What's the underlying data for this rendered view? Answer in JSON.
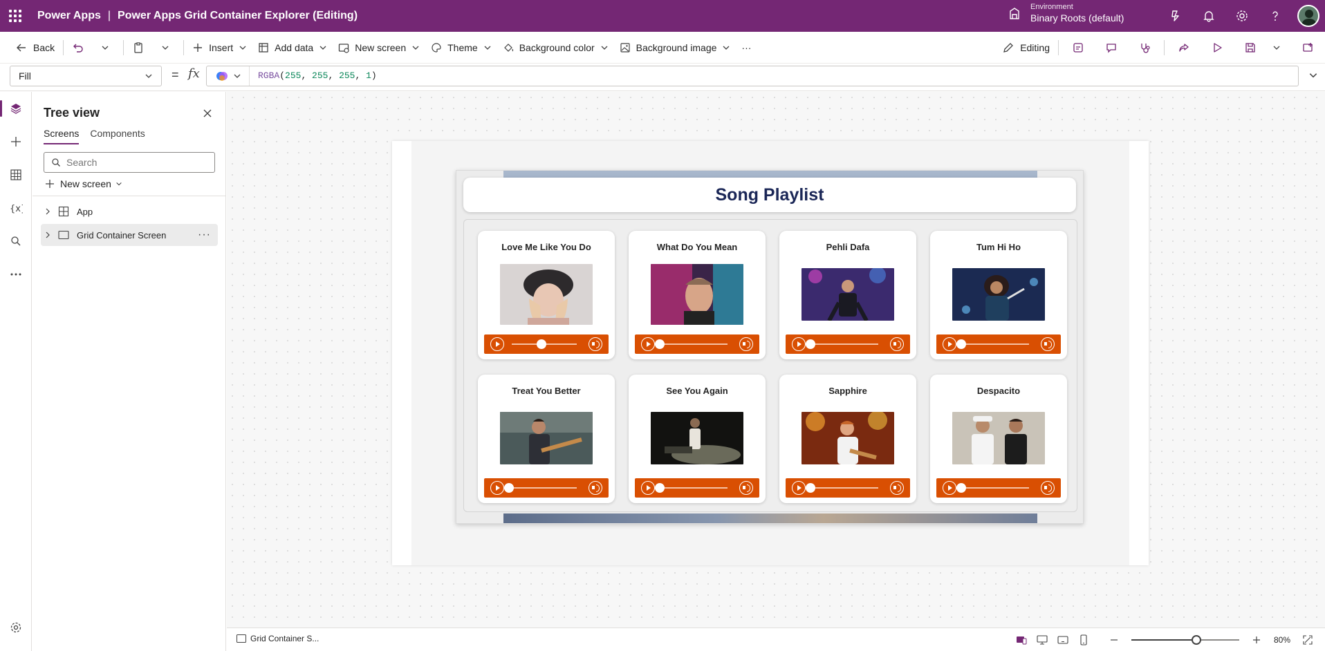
{
  "topbar": {
    "brand": "Power Apps",
    "separator": "|",
    "title": "Power Apps Grid Container Explorer (Editing)",
    "environment_label": "Environment",
    "environment_name": "Binary Roots (default)"
  },
  "commandbar": {
    "back": "Back",
    "insert": "Insert",
    "add_data": "Add data",
    "new_screen": "New screen",
    "theme": "Theme",
    "background_color": "Background color",
    "background_image": "Background image",
    "more": "···",
    "editing": "Editing"
  },
  "formula": {
    "property": "Fill",
    "equals": "=",
    "fx": "fx",
    "fn": "RGBA",
    "args": [
      "255",
      "255",
      "255",
      "1"
    ]
  },
  "tree": {
    "title": "Tree view",
    "tabs": [
      "Screens",
      "Components"
    ],
    "search_placeholder": "Search",
    "new_screen": "New screen",
    "items": [
      {
        "label": "App"
      },
      {
        "label": "Grid Container Screen"
      }
    ]
  },
  "app": {
    "header": "Song Playlist",
    "songs": [
      {
        "title": "Love Me Like You Do",
        "progress": 0.5
      },
      {
        "title": "What Do You Mean",
        "progress": 0.0
      },
      {
        "title": "Pehli Dafa",
        "progress": 0.0
      },
      {
        "title": "Tum Hi Ho",
        "progress": 0.0
      },
      {
        "title": "Treat You Better",
        "progress": 0.0
      },
      {
        "title": "See You Again",
        "progress": 0.0
      },
      {
        "title": "Sapphire",
        "progress": 0.0
      },
      {
        "title": "Despacito",
        "progress": 0.0
      }
    ]
  },
  "status": {
    "screen_name": "Grid Container S...",
    "zoom": "80%",
    "zoom_level": 0.6
  },
  "colors": {
    "brand": "#742774",
    "player": "#D94F02",
    "header_text": "#1B2757"
  }
}
